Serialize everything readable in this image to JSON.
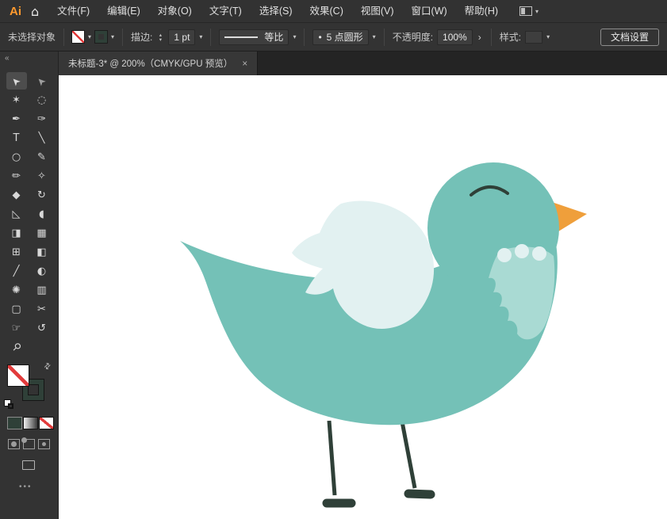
{
  "menu_bar": {
    "logo": "Ai",
    "home_glyph": "⌂",
    "items": [
      {
        "name": "file",
        "label": "文件(F)"
      },
      {
        "name": "edit",
        "label": "编辑(E)"
      },
      {
        "name": "object",
        "label": "对象(O)"
      },
      {
        "name": "type",
        "label": "文字(T)"
      },
      {
        "name": "select",
        "label": "选择(S)"
      },
      {
        "name": "effect",
        "label": "效果(C)"
      },
      {
        "name": "view",
        "label": "视图(V)"
      },
      {
        "name": "window",
        "label": "窗口(W)"
      },
      {
        "name": "help",
        "label": "帮助(H)"
      }
    ]
  },
  "icons": {
    "chevron": "▾",
    "stepper_up": "▴",
    "stepper_down": "▾",
    "expand": "›",
    "swap": "⇄"
  },
  "control_bar": {
    "selection_status": "未选择对象",
    "stroke_label": "描边:",
    "stroke_weight": "1 pt",
    "width_profile": "等比",
    "brush_bullet": "•",
    "brush_name": "5 点圆形",
    "opacity_label": "不透明度:",
    "opacity_value": "100%",
    "style_label": "样式:",
    "document_setup": "文档设置"
  },
  "document_tab": {
    "title": "未标题-3* @ 200%（CMYK/GPU 预览）",
    "close_glyph": "×"
  },
  "toolbar": {
    "collapse_glyph": "«",
    "more_glyph": "•••",
    "tools": [
      {
        "name": "selection-tool",
        "glyph": "➤",
        "rot": -135,
        "active": true
      },
      {
        "name": "direct-selection-tool",
        "glyph": "➤",
        "rot": -135,
        "dim": true
      },
      {
        "name": "magic-wand-tool",
        "glyph": "✶"
      },
      {
        "name": "lasso-tool",
        "glyph": "◌"
      },
      {
        "name": "pen-tool",
        "glyph": "✒"
      },
      {
        "name": "curvature-tool",
        "glyph": "✑"
      },
      {
        "name": "type-tool",
        "glyph": "T"
      },
      {
        "name": "line-segment-tool",
        "glyph": "╲"
      },
      {
        "name": "ellipse-tool",
        "glyph": "○"
      },
      {
        "name": "paintbrush-tool",
        "glyph": "✎"
      },
      {
        "name": "pencil-tool",
        "glyph": "✏"
      },
      {
        "name": "shaper-tool",
        "glyph": "✧"
      },
      {
        "name": "eraser-tool",
        "glyph": "◆"
      },
      {
        "name": "rotate-tool",
        "glyph": "↻"
      },
      {
        "name": "scale-tool",
        "glyph": "◺"
      },
      {
        "name": "width-tool",
        "glyph": "◖"
      },
      {
        "name": "shape-builder-tool",
        "glyph": "◨"
      },
      {
        "name": "perspective-grid-tool",
        "glyph": "▦"
      },
      {
        "name": "mesh-tool",
        "glyph": "⊞"
      },
      {
        "name": "gradient-tool",
        "glyph": "◧"
      },
      {
        "name": "eyedropper-tool",
        "glyph": "╱"
      },
      {
        "name": "blend-tool",
        "glyph": "◐"
      },
      {
        "name": "symbol-sprayer-tool",
        "glyph": "✺"
      },
      {
        "name": "column-graph-tool",
        "glyph": "▥"
      },
      {
        "name": "artboard-tool",
        "glyph": "▢"
      },
      {
        "name": "slice-tool",
        "glyph": "✂"
      },
      {
        "name": "hand-tool",
        "glyph": "☞"
      },
      {
        "name": "rotate-view-tool",
        "glyph": "↺"
      },
      {
        "name": "zoom-tool",
        "glyph": "⚲",
        "rot": 45
      }
    ]
  },
  "artwork": {
    "description": "teal bird illustration",
    "colors": {
      "body": "#74c1b7",
      "wing": "#e2f1f1",
      "chest": "#a9dad3",
      "beak": "#ef9f3b",
      "line": "#2f4038"
    }
  }
}
